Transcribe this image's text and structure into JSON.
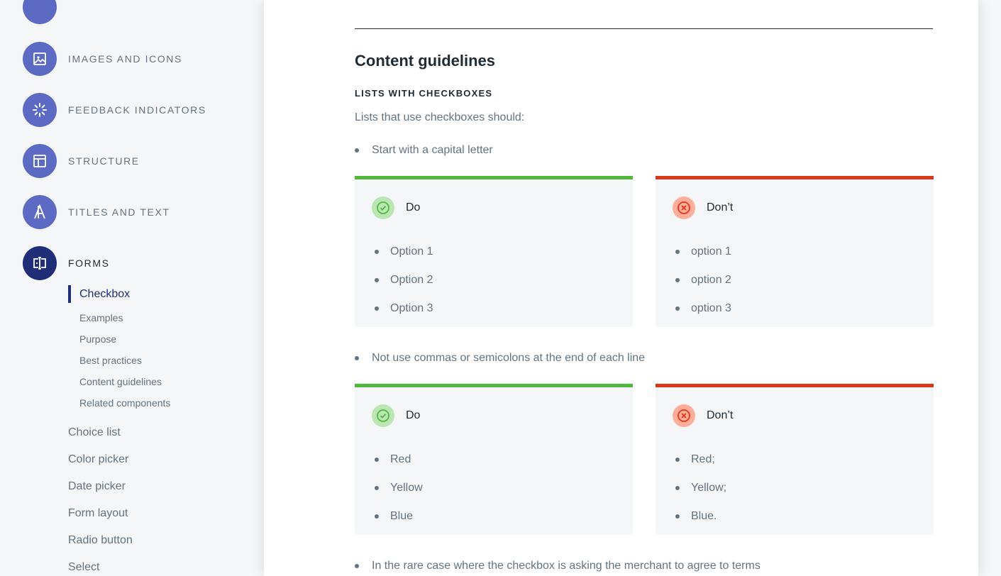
{
  "sidebar": {
    "categories": [
      {
        "label": "",
        "icon": "top-partial-icon"
      },
      {
        "label": "IMAGES AND ICONS",
        "icon": "image-icon"
      },
      {
        "label": "FEEDBACK INDICATORS",
        "icon": "spinner-icon"
      },
      {
        "label": "STRUCTURE",
        "icon": "layout-icon"
      },
      {
        "label": "TITLES AND TEXT",
        "icon": "typography-icon"
      },
      {
        "label": "FORMS",
        "icon": "form-field-icon"
      }
    ],
    "active_item": "Checkbox",
    "active_subitems": [
      "Examples",
      "Purpose",
      "Best practices",
      "Content guidelines",
      "Related components"
    ],
    "items": [
      "Choice list",
      "Color picker",
      "Date picker",
      "Form layout",
      "Radio button",
      "Select"
    ]
  },
  "content": {
    "heading": "Content guidelines",
    "subheading": "LISTS WITH CHECKBOXES",
    "intro": "Lists that use checkboxes should:",
    "rules": [
      {
        "text": "Start with a capital letter",
        "do": {
          "title": "Do",
          "items": [
            "Option 1",
            "Option 2",
            "Option 3"
          ]
        },
        "dont": {
          "title": "Don’t",
          "items": [
            "option 1",
            "option 2",
            "option 3"
          ]
        }
      },
      {
        "text": "Not use commas or semicolons at the end of each line",
        "do": {
          "title": "Do",
          "items": [
            "Red",
            "Yellow",
            "Blue"
          ]
        },
        "dont": {
          "title": "Don’t",
          "items": [
            "Red;",
            "Yellow;",
            "Blue."
          ]
        }
      }
    ],
    "trailing_bullet": "In the rare case where the checkbox is asking the merchant to agree to terms"
  },
  "colors": {
    "accent": "#5c6ac4",
    "accent_active": "#202e78",
    "do": "#50b83c",
    "dont": "#de3618"
  }
}
